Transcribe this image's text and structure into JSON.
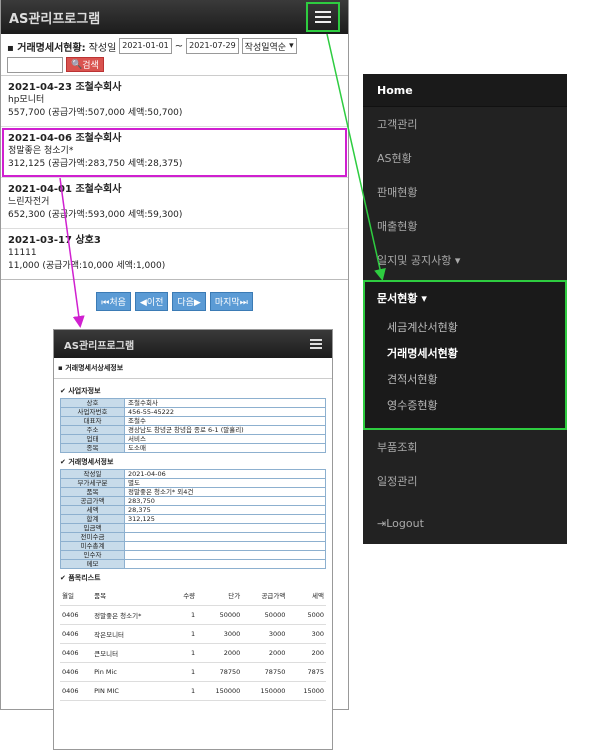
{
  "main": {
    "title": "AS관리프로그램",
    "filter": {
      "label": "거래명세서현황:",
      "date_field": "작성일",
      "date_from": "2021-01-01",
      "tilde": "~",
      "date_to": "2021-07-29",
      "sort": "작성일역순",
      "search_btn": "검색"
    },
    "items": [
      {
        "title": "2021-04-23 조철수회사",
        "sub": "hp모니터",
        "amount": "557,700 (공급가액:507,000 세액:50,700)"
      },
      {
        "title": "2021-04-06 조철수회사",
        "sub": "정말좋은 청소기*",
        "amount": "312,125 (공급가액:283,750 세액:28,375)"
      },
      {
        "title": "2021-04-01 조철수회사",
        "sub": "느린자전거",
        "amount": "652,300 (공급가액:593,000 세액:59,300)"
      },
      {
        "title": "2021-03-17 상호3",
        "sub": "11111",
        "amount": "11,000 (공급가액:10,000 세액:1,000)"
      }
    ],
    "pager": [
      "처음",
      "이전",
      "다음",
      "마지막"
    ]
  },
  "menu": {
    "home": "Home",
    "items_top": [
      "고객관리",
      "AS현황",
      "판매현황",
      "매출현황",
      "일지및 공지사항"
    ],
    "section": "문서현황",
    "subs": [
      "세금계산서현황",
      "거래명세서현황",
      "견적서현황",
      "영수증현황"
    ],
    "items_bottom": [
      "부품조회",
      "일정관리"
    ],
    "logout": "Logout"
  },
  "detail": {
    "title": "AS관리프로그램",
    "header": "거래명세서상세정보",
    "biz_title": "사업자정보",
    "biz": [
      [
        "상호",
        "조철수회사"
      ],
      [
        "사업자번호",
        "456-55-45222"
      ],
      [
        "대표자",
        "조철수"
      ],
      [
        "주소",
        "경상남도 창녕군 창녕읍 종로 6-1 (말흘리)"
      ],
      [
        "업태",
        "서비스"
      ],
      [
        "종목",
        "도소매"
      ]
    ],
    "stmt_title": "거래명세서정보",
    "stmt": [
      [
        "작성일",
        "2021-04-06"
      ],
      [
        "부가세구분",
        "별도"
      ],
      [
        "품목",
        "정말좋은 청소기* 외4건"
      ],
      [
        "공급가액",
        "283,750"
      ],
      [
        "세액",
        "28,375"
      ],
      [
        "합계",
        "312,125"
      ],
      [
        "입금액",
        ""
      ],
      [
        "전미수금",
        ""
      ],
      [
        "미수총계",
        ""
      ],
      [
        "인수자",
        ""
      ],
      [
        "메모",
        ""
      ]
    ],
    "list_title": "품목리스트",
    "list_head": [
      "월일",
      "품목",
      "수량",
      "단가",
      "공급가액",
      "세액"
    ],
    "rows": [
      [
        "0406",
        "정말좋은 청소기*",
        "1",
        "50000",
        "50000",
        "5000"
      ],
      [
        "0406",
        "작은모니터",
        "1",
        "3000",
        "3000",
        "300"
      ],
      [
        "0406",
        "큰모니터",
        "1",
        "2000",
        "2000",
        "200"
      ],
      [
        "0406",
        "Pin Mic",
        "1",
        "78750",
        "78750",
        "7875"
      ],
      [
        "0406",
        "PIN MIC",
        "1",
        "150000",
        "150000",
        "15000"
      ]
    ]
  },
  "colors": {
    "green": "#2ecc40",
    "magenta": "#d020d0",
    "dark": "#222222"
  }
}
